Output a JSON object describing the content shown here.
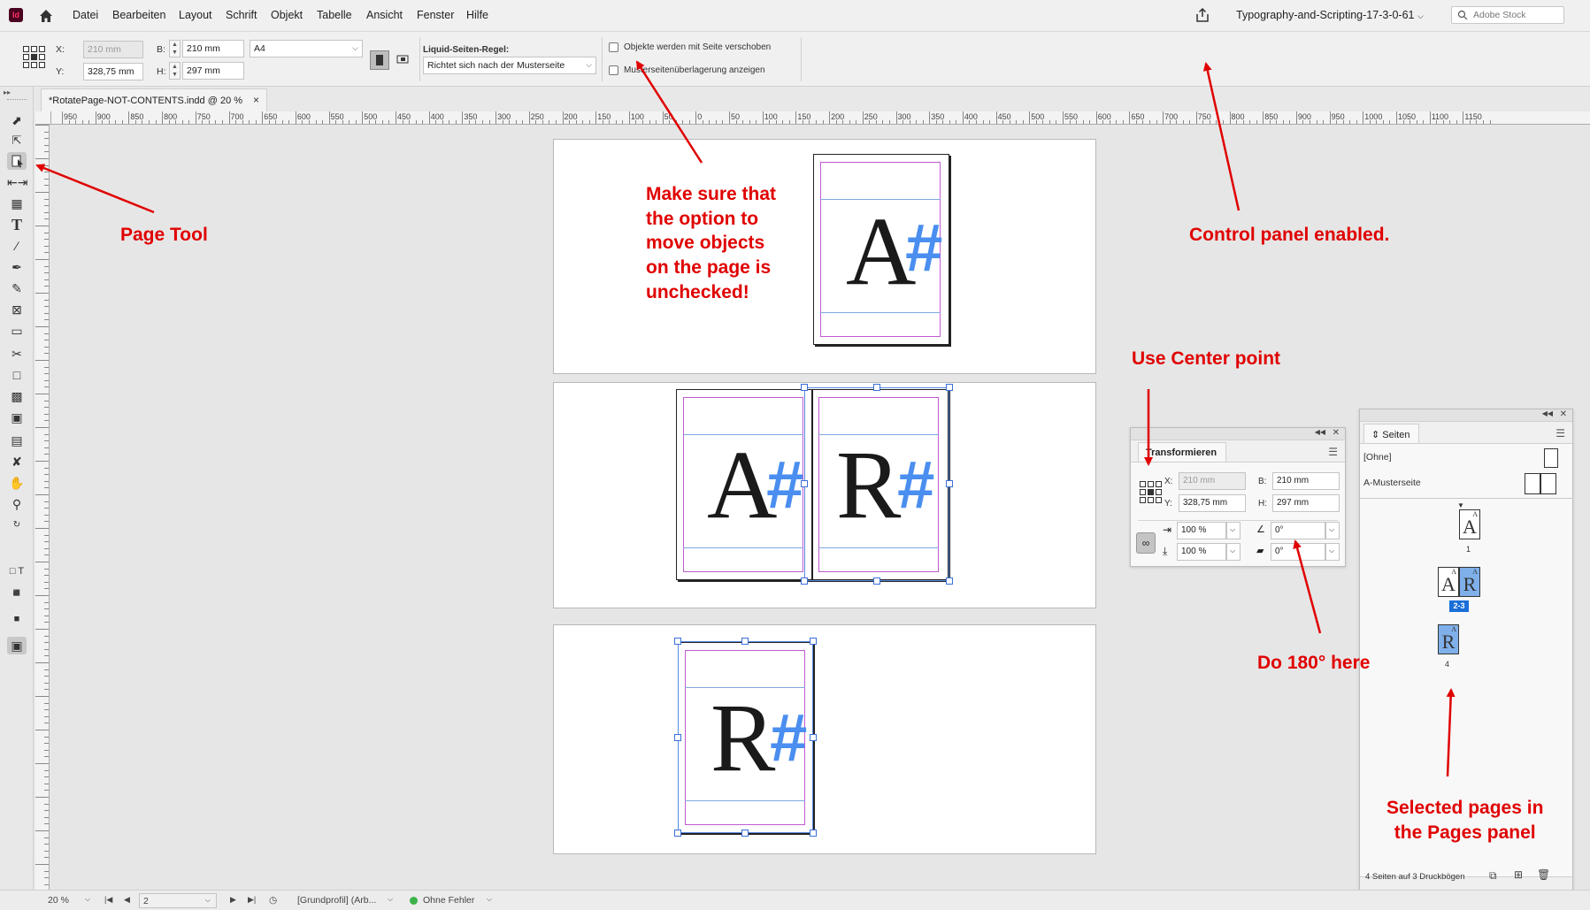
{
  "app": {
    "icon_label": "Id"
  },
  "menu": {
    "items": [
      "Datei",
      "Bearbeiten",
      "Layout",
      "Schrift",
      "Objekt",
      "Tabelle",
      "Ansicht",
      "Fenster",
      "Hilfe"
    ],
    "doc_name": "Typography-and-Scripting-17-3-0-61",
    "search_placeholder": "Adobe Stock"
  },
  "control": {
    "x_label": "X:",
    "x_value": "210 mm",
    "y_label": "Y:",
    "y_value": "328,75 mm",
    "w_label": "B:",
    "w_value": "210 mm",
    "h_label": "H:",
    "h_value": "297 mm",
    "size_preset": "A4",
    "liquid_label": "Liquid-Seiten-Regel:",
    "liquid_value": "Richtet sich nach der Musterseite",
    "move_objects_label": "Objekte werden mit Seite verschoben",
    "master_overlay_label": "Musterseitenüberlagerung anzeigen"
  },
  "document_tab": {
    "title": "*RotatePage-NOT-CONTENTS.indd @ 20 %",
    "close": "×"
  },
  "ruler": {
    "labels": [
      "950",
      "900",
      "850",
      "800",
      "750",
      "700",
      "650",
      "600",
      "550",
      "500",
      "450",
      "400",
      "350",
      "300",
      "250",
      "200",
      "150",
      "100",
      "50",
      "0",
      "50",
      "100",
      "150",
      "200",
      "250",
      "300",
      "350",
      "400",
      "450",
      "500",
      "550",
      "600",
      "650",
      "700",
      "750",
      "800",
      "850",
      "900",
      "950",
      "1000",
      "1050",
      "1100",
      "1150"
    ]
  },
  "pages": {
    "glyph_a": "A",
    "glyph_r": "R",
    "glyph_hash": "#"
  },
  "annotations": {
    "page_tool": "Page Tool",
    "make_sure": "Make sure that\nthe option to\nmove objects\non the page is\nunchecked!",
    "control_panel": "Control panel enabled.",
    "center_point": "Use Center point",
    "do_180": "Do 180° here",
    "selected_pages": "Selected pages in\nthe Pages panel"
  },
  "transform_panel": {
    "title": "Transformieren",
    "x_label": "X:",
    "x_value": "210 mm",
    "y_label": "Y:",
    "y_value": "328,75 mm",
    "w_label": "B:",
    "w_value": "210 mm",
    "h_label": "H:",
    "h_value": "297 mm",
    "scale_x": "100 %",
    "scale_y": "100 %",
    "rotate": "0°",
    "shear": "0°"
  },
  "pages_panel": {
    "title": "Seiten",
    "none_label": "[Ohne]",
    "master_label": "A-Musterseite",
    "page1_num": "1",
    "spread_label": "2-3",
    "page4_num": "4",
    "footer": "4 Seiten auf 3 Druckbögen",
    "thumb_master_letter": "A",
    "thumb_a_big": "A",
    "thumb_r_big": "R"
  },
  "status": {
    "zoom": "20 %",
    "page": "2",
    "profile": "[Grundprofil] (Arb...",
    "errors": "Ohne Fehler"
  },
  "colors": {
    "annotation": "#e00000",
    "accent_blue": "#4a8ef0",
    "margin": "#c05ad0",
    "ok_green": "#3cb34a"
  }
}
